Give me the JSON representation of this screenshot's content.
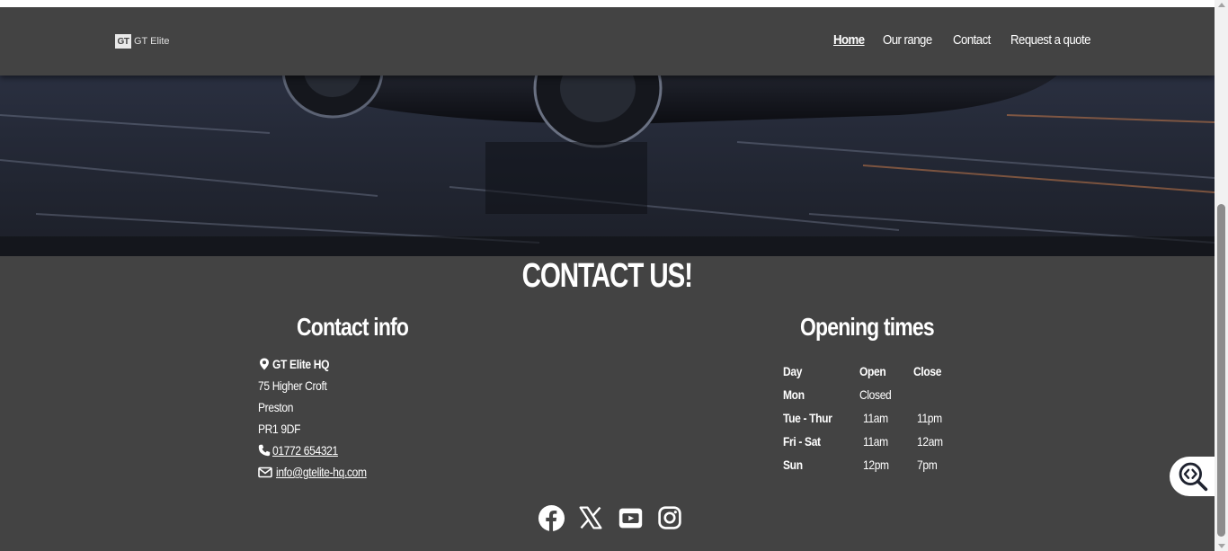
{
  "brand": {
    "mark": "GT",
    "name": "GT Elite"
  },
  "nav": {
    "items": [
      {
        "label": "Home",
        "active": true
      },
      {
        "label": "Our range",
        "active": false
      },
      {
        "label": "Contact",
        "active": false
      },
      {
        "label": "Request a quote",
        "active": false
      }
    ]
  },
  "contact": {
    "section_title": "CONTACT US!",
    "info_title": "Contact info",
    "name": "GT Elite HQ",
    "address_line1": "75 Higher Croft",
    "address_line2": "Preston",
    "postcode": "PR1 9DF",
    "phone": "01772 654321",
    "email": "info@gtelite-hq.com"
  },
  "opening_times": {
    "title": "Opening times",
    "headers": {
      "day": "Day",
      "open": "Open",
      "close": "Close"
    },
    "rows": [
      {
        "day": "Mon",
        "open": "Closed",
        "close": ""
      },
      {
        "day": "Tue - Thur",
        "open": "11am",
        "close": "11pm"
      },
      {
        "day": "Fri - Sat",
        "open": "11am",
        "close": "12am"
      },
      {
        "day": "Sun",
        "open": "12pm",
        "close": "7pm"
      }
    ]
  },
  "socials": [
    "facebook-icon",
    "x-icon",
    "youtube-icon",
    "instagram-icon"
  ],
  "colors": {
    "background": "#434343",
    "text": "#ffffff"
  }
}
